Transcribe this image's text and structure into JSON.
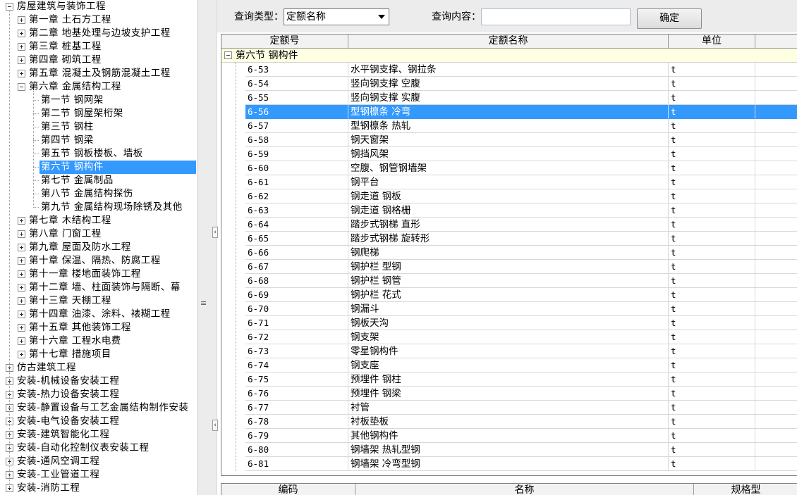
{
  "tree": {
    "root": {
      "label": "房屋建筑与装饰工程"
    },
    "chapters_before": [
      {
        "label": "第一章  土石方工程"
      },
      {
        "label": "第二章  地基处理与边坡支护工程"
      },
      {
        "label": "第三章  桩基工程"
      },
      {
        "label": "第四章  砌筑工程"
      },
      {
        "label": "第五章  混凝土及钢筋混凝土工程"
      }
    ],
    "open_chapter": {
      "label": "第六章  金属结构工程"
    },
    "sections": [
      {
        "label": "第一节  钢网架"
      },
      {
        "label": "第二节  钢屋架桁架"
      },
      {
        "label": "第三节  钢柱"
      },
      {
        "label": "第四节  钢梁"
      },
      {
        "label": "第五节  钢板楼板、墙板"
      },
      {
        "label": "第六节  钢构件"
      },
      {
        "label": "第七节  金属制品"
      },
      {
        "label": "第八节  金属结构探伤"
      },
      {
        "label": "第九节  金属结构现场除锈及其他"
      }
    ],
    "selected_section": 5,
    "chapters_after": [
      {
        "label": "第七章  木结构工程"
      },
      {
        "label": "第八章  门窗工程"
      },
      {
        "label": "第九章  屋面及防水工程"
      },
      {
        "label": "第十章  保温、隔热、防腐工程"
      },
      {
        "label": "第十一章  楼地面装饰工程"
      },
      {
        "label": "第十二章  墙、柱面装饰与隔断、幕"
      },
      {
        "label": "第十三章  天棚工程"
      },
      {
        "label": "第十四章  油漆、涂料、裱糊工程"
      },
      {
        "label": "第十五章  其他装饰工程"
      },
      {
        "label": "第十六章  工程水电费"
      },
      {
        "label": "第十七章  措施项目"
      }
    ],
    "other_roots": [
      {
        "label": "仿古建筑工程"
      },
      {
        "label": "安装-机械设备安装工程"
      },
      {
        "label": "安装-热力设备安装工程"
      },
      {
        "label": "安装-静置设备与工艺金属结构制作安装"
      },
      {
        "label": "安装-电气设备安装工程"
      },
      {
        "label": "安装-建筑智能化工程"
      },
      {
        "label": "安装-自动化控制仪表安装工程"
      },
      {
        "label": "安装-通风空调工程"
      },
      {
        "label": "安装-工业管道工程"
      },
      {
        "label": "安装-消防工程"
      }
    ]
  },
  "splitter": {
    "collapse_left": "‹",
    "collapse_left2": "‹",
    "grip": "≡"
  },
  "query": {
    "type_label": "查询类型：",
    "type_value": "定额名称",
    "content_label": "查询内容：",
    "content_value": "",
    "confirm_label": "确定"
  },
  "grid": {
    "columns": [
      "定额号",
      "定额名称",
      "单位",
      ""
    ],
    "group_label": "第六节  钢构件",
    "selected_row": 3,
    "rows": [
      {
        "code": "6-53",
        "name": "水平钢支撑、钢拉条",
        "unit": "t"
      },
      {
        "code": "6-54",
        "name": "竖向钢支撑 空腹",
        "unit": "t"
      },
      {
        "code": "6-55",
        "name": "竖向钢支撑 实腹",
        "unit": "t"
      },
      {
        "code": "6-56",
        "name": "型钢檩条 冷弯",
        "unit": "t"
      },
      {
        "code": "6-57",
        "name": "型钢檩条 热轧",
        "unit": "t"
      },
      {
        "code": "6-58",
        "name": "钢天窗架",
        "unit": "t"
      },
      {
        "code": "6-59",
        "name": "钢挡风架",
        "unit": "t"
      },
      {
        "code": "6-60",
        "name": "空腹、钢管钢墙架",
        "unit": "t"
      },
      {
        "code": "6-61",
        "name": "钢平台",
        "unit": "t"
      },
      {
        "code": "6-62",
        "name": "钢走道 钢板",
        "unit": "t"
      },
      {
        "code": "6-63",
        "name": "钢走道 钢格栅",
        "unit": "t"
      },
      {
        "code": "6-64",
        "name": "踏步式钢梯 直形",
        "unit": "t"
      },
      {
        "code": "6-65",
        "name": "踏步式钢梯 旋转形",
        "unit": "t"
      },
      {
        "code": "6-66",
        "name": "钢爬梯",
        "unit": "t"
      },
      {
        "code": "6-67",
        "name": "钢护栏 型钢",
        "unit": "t"
      },
      {
        "code": "6-68",
        "name": "钢护栏 钢管",
        "unit": "t"
      },
      {
        "code": "6-69",
        "name": "钢护栏 花式",
        "unit": "t"
      },
      {
        "code": "6-70",
        "name": "钢漏斗",
        "unit": "t"
      },
      {
        "code": "6-71",
        "name": "钢板天沟",
        "unit": "t"
      },
      {
        "code": "6-72",
        "name": "钢支架",
        "unit": "t"
      },
      {
        "code": "6-73",
        "name": "零星钢构件",
        "unit": "t"
      },
      {
        "code": "6-74",
        "name": "钢支座",
        "unit": "t"
      },
      {
        "code": "6-75",
        "name": "预埋件 钢柱",
        "unit": "t"
      },
      {
        "code": "6-76",
        "name": "预埋件 钢梁",
        "unit": "t"
      },
      {
        "code": "6-77",
        "name": "衬管",
        "unit": "t"
      },
      {
        "code": "6-78",
        "name": "衬板垫板",
        "unit": "t"
      },
      {
        "code": "6-79",
        "name": "其他钢构件",
        "unit": "t"
      },
      {
        "code": "6-80",
        "name": "钢墙架 热轧型钢",
        "unit": "t"
      },
      {
        "code": "6-81",
        "name": "钢墙架 冷弯型钢",
        "unit": "t"
      }
    ]
  },
  "grid2": {
    "columns": [
      "编码",
      "名称",
      "规格型"
    ]
  },
  "colors": {
    "selection": "#3399ff",
    "group_row": "#ffffe1",
    "panel": "#ececec"
  }
}
